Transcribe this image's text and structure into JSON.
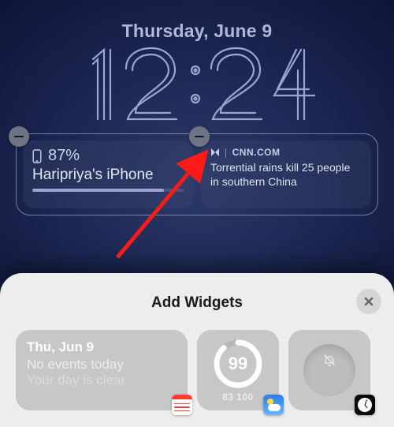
{
  "lockscreen": {
    "date": "Thursday, June 9",
    "time": "12:24",
    "widgets": {
      "battery": {
        "percent_label": "87%",
        "device_name": "Haripriya's iPhone",
        "percent_value": 87
      },
      "news": {
        "source": "CNN.COM",
        "headline": "Torrential rains kill 25 people in southern China"
      }
    }
  },
  "sheet": {
    "title": "Add Widgets",
    "tiles": {
      "calendar": {
        "date_short": "Thu, Jun 9",
        "line1": "No events today",
        "line2": "Your day is clear"
      },
      "aqi": {
        "value": "99",
        "range": "83 100"
      }
    }
  },
  "icons": {
    "phone": "phone-icon",
    "applenews": "applenews-icon",
    "close": "close-icon",
    "bell_slash": "bell-slash-icon"
  }
}
